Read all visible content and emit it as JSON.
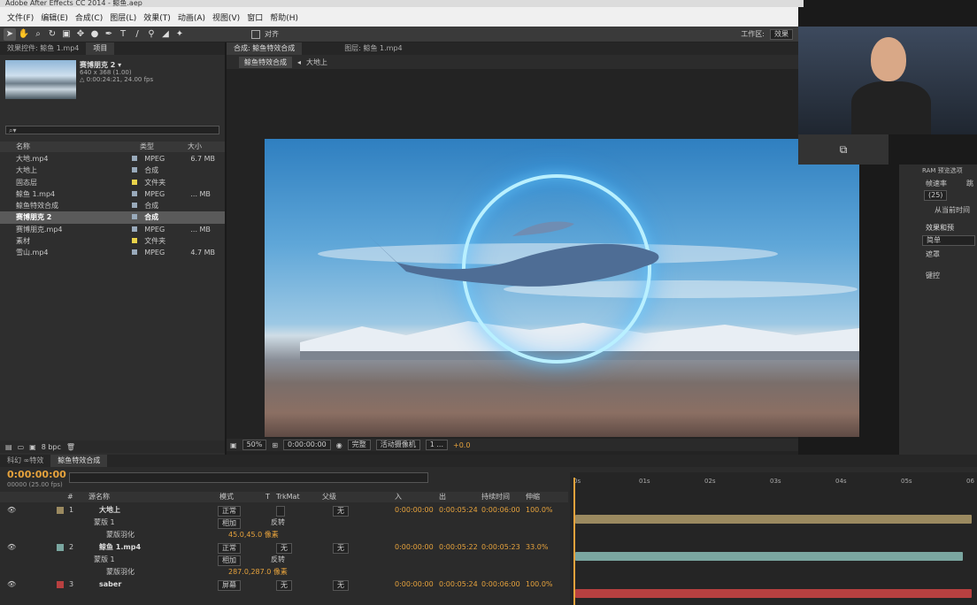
{
  "app": {
    "title": "Adobe After Effects CC 2014 - 鲸鱼.aep"
  },
  "menu": [
    "文件(F)",
    "编辑(E)",
    "合成(C)",
    "图层(L)",
    "效果(T)",
    "动画(A)",
    "视图(V)",
    "窗口",
    "帮助(H)"
  ],
  "toolbar": {
    "snap_label": "对齐",
    "workspace_label": "工作区:",
    "workspace_value": "效果"
  },
  "left_panel": {
    "tabs": [
      "效果控件: 鲸鱼 1.mp4",
      "项目"
    ],
    "preview_name": "赛博朋克 2 ▾",
    "preview_meta1": "640 x 368 (1.00)",
    "preview_meta2": "△ 0:00:24:21, 24.00 fps",
    "search_placeholder": "⌕▾",
    "columns": {
      "name": "名称",
      "type": "类型",
      "size": "大小"
    },
    "items": [
      {
        "name": "大地.mp4",
        "type": "MPEG",
        "size": "6.7 MB",
        "color": "#9ab"
      },
      {
        "name": "大地上",
        "type": "合成",
        "size": "",
        "color": "#9ab"
      },
      {
        "name": "固态层",
        "type": "文件夹",
        "size": "",
        "color": "#e8d24a"
      },
      {
        "name": "鲸鱼 1.mp4",
        "type": "MPEG",
        "size": "... MB",
        "color": "#9ab"
      },
      {
        "name": "鲸鱼特效合成",
        "type": "合成",
        "size": "",
        "color": "#9ab"
      },
      {
        "name": "赛博朋克 2",
        "type": "合成",
        "size": "",
        "color": "#9ab"
      },
      {
        "name": "赛博朋克.mp4",
        "type": "MPEG",
        "size": "... MB",
        "color": "#9ab"
      },
      {
        "name": "素材",
        "type": "文件夹",
        "size": "",
        "color": "#e8d24a"
      },
      {
        "name": "雪山.mp4",
        "type": "MPEG",
        "size": "4.7 MB",
        "color": "#9ab"
      }
    ],
    "bpc": "8 bpc"
  },
  "comp_panel": {
    "tabs": [
      "合成: 鲸鱼特效合成",
      "图层: 鲸鱼 1.mp4"
    ],
    "breadcrumb": [
      "鲸鱼特效合成",
      "大地上"
    ],
    "zoom": "50%",
    "timecode": "0:00:00:00",
    "quality": "完整",
    "camera": "活动摄像机",
    "views": "1 ...",
    "exposure": "+0.0"
  },
  "right_panel": {
    "ram_title": "RAM 预览选项",
    "fps_label": "帧速率",
    "skip_label": "跳",
    "fps_value": "(25)",
    "from_current": "从当前时间",
    "effects_title": "效果和预",
    "search_value": "简单",
    "groups": [
      "遮罩",
      "键控"
    ]
  },
  "timeline": {
    "tabs": [
      "科幻 ∞特效",
      "鲸鱼特效合成"
    ],
    "timecode": "0:00:00:00",
    "timecode_sub": "00000 (25.00 fps)",
    "headers": {
      "num": "#",
      "source": "源名称",
      "mode": "模式",
      "t": "T",
      "trkmat": "TrkMat",
      "parent": "父级",
      "in": "入",
      "out": "出",
      "duration": "持续时间",
      "stretch": "伸缩"
    },
    "ruler": [
      "0s",
      "01s",
      "02s",
      "03s",
      "04s",
      "05s",
      "06"
    ],
    "rows": [
      {
        "num": "1",
        "name": "大地上",
        "mode": "正常",
        "trk": "",
        "parent": "无",
        "in": "0:00:00:00",
        "out": "0:00:05:24",
        "dur": "0:00:06:00",
        "stretch": "100.0%",
        "color": "#9b8a60"
      },
      {
        "sub": "蒙版 1",
        "mode": "相加",
        "invert": "反转"
      },
      {
        "subsub": "蒙版羽化",
        "value": "45.0,45.0 像素"
      },
      {
        "num": "2",
        "name": "鲸鱼 1.mp4",
        "mode": "正常",
        "trk": "无",
        "parent": "无",
        "in": "0:00:00:00",
        "out": "0:00:05:22",
        "dur": "0:00:05:23",
        "stretch": "33.0%",
        "color": "#7aa6a0"
      },
      {
        "sub": "蒙版 1",
        "mode": "相加",
        "invert": "反转"
      },
      {
        "subsub": "蒙版羽化",
        "value": "287.0,287.0 像素"
      },
      {
        "num": "3",
        "name": "saber",
        "mode": "屏幕",
        "trk": "无",
        "parent": "无",
        "in": "0:00:00:00",
        "out": "0:00:05:24",
        "dur": "0:00:06:00",
        "stretch": "100.0%",
        "color": "#b84040"
      }
    ]
  },
  "colors": {
    "accent_orange": "#e6a23c",
    "bar1": "#9b8a60",
    "bar2": "#7aa6a0",
    "bar3": "#b84040"
  }
}
